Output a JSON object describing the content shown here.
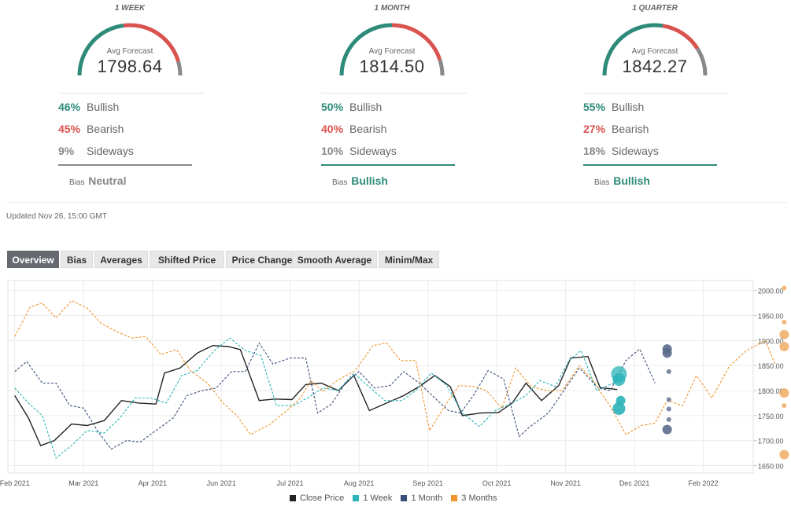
{
  "forecasts": [
    {
      "period": "1 WEEK",
      "avg_label": "Avg Forecast",
      "avg_value": "1798.64",
      "bullish_pct": "46%",
      "bullish_label": "Bullish",
      "bearish_pct": "45%",
      "bearish_label": "Bearish",
      "sideways_pct": "9%",
      "sideways_label": "Sideways",
      "bias_label": "Bias",
      "bias_value": "Neutral",
      "bias_color": "#888888",
      "gauge": {
        "bullish": 0.46,
        "bearish": 0.45,
        "sideways": 0.09
      }
    },
    {
      "period": "1 MONTH",
      "avg_label": "Avg Forecast",
      "avg_value": "1814.50",
      "bullish_pct": "50%",
      "bullish_label": "Bullish",
      "bearish_pct": "40%",
      "bearish_label": "Bearish",
      "sideways_pct": "10%",
      "sideways_label": "Sideways",
      "bias_label": "Bias",
      "bias_value": "Bullish",
      "bias_color": "#2e8b7a",
      "gauge": {
        "bullish": 0.5,
        "bearish": 0.4,
        "sideways": 0.1
      }
    },
    {
      "period": "1 QUARTER",
      "avg_label": "Avg Forecast",
      "avg_value": "1842.27",
      "bullish_pct": "55%",
      "bullish_label": "Bullish",
      "bearish_pct": "27%",
      "bearish_label": "Bearish",
      "sideways_pct": "18%",
      "sideways_label": "Sideways",
      "bias_label": "Bias",
      "bias_value": "Bullish",
      "bias_color": "#2e8b7a",
      "gauge": {
        "bullish": 0.55,
        "bearish": 0.27,
        "sideways": 0.18
      }
    }
  ],
  "colors": {
    "bullish": "#2e8b7a",
    "bearish": "#d9534f",
    "sideways": "#888888"
  },
  "updated": "Updated Nov 26, 15:00 GMT",
  "tabs": [
    {
      "label": "Overview",
      "active": true
    },
    {
      "label": "Bias",
      "active": false
    },
    {
      "label": "Averages",
      "active": false
    },
    {
      "label": "Shifted Price",
      "active": false
    },
    {
      "label": "Price Change",
      "active": false
    },
    {
      "label": "Smooth Average",
      "active": false
    },
    {
      "label": "Minim/Max",
      "active": false
    }
  ],
  "chart_data": {
    "type": "line",
    "x_ticks": [
      "Feb 2021",
      "Mar 2021",
      "Apr 2021",
      "Jun 2021",
      "Jul 2021",
      "Aug 2021",
      "Sep 2021",
      "Oct 2021",
      "Nov 2021",
      "Dec 2021",
      "Feb 2022"
    ],
    "x_tick_weeks": [
      0,
      4,
      8,
      12,
      16,
      20,
      24,
      28,
      32,
      36,
      40
    ],
    "y_ticks": [
      "2000.00",
      "1950.00",
      "1900.00",
      "1850.00",
      "1800.00",
      "1750.00",
      "1700.00",
      "1650.00"
    ],
    "ylim": [
      1635,
      2020
    ],
    "xlim": [
      -0.4,
      42.9
    ],
    "grid": true,
    "legend_position": "bottom",
    "series": [
      {
        "name": "Close Price",
        "color": "#222222",
        "dashed": false,
        "values": [
          [
            0,
            1790
          ],
          [
            0.8,
            1745
          ],
          [
            1.5,
            1690
          ],
          [
            2.3,
            1700
          ],
          [
            3.3,
            1733
          ],
          [
            4.2,
            1730
          ],
          [
            5.2,
            1740
          ],
          [
            6.2,
            1780
          ],
          [
            7.2,
            1775
          ],
          [
            8.2,
            1773
          ],
          [
            8.7,
            1835
          ],
          [
            9.6,
            1845
          ],
          [
            10.6,
            1875
          ],
          [
            11.5,
            1890
          ],
          [
            12.4,
            1888
          ],
          [
            13.1,
            1882
          ],
          [
            14.2,
            1780
          ],
          [
            15.1,
            1783
          ],
          [
            16.1,
            1782
          ],
          [
            16.9,
            1812
          ],
          [
            17.8,
            1815
          ],
          [
            18.8,
            1800
          ],
          [
            19.7,
            1830
          ],
          [
            20.6,
            1760
          ],
          [
            21.6,
            1775
          ],
          [
            22.6,
            1790
          ],
          [
            23.5,
            1808
          ],
          [
            24.4,
            1830
          ],
          [
            25.3,
            1808
          ],
          [
            26.0,
            1750
          ],
          [
            27.1,
            1755
          ],
          [
            28.1,
            1756
          ],
          [
            28.9,
            1775
          ],
          [
            29.7,
            1815
          ],
          [
            30.6,
            1780
          ],
          [
            31.6,
            1810
          ],
          [
            32.3,
            1865
          ],
          [
            33.3,
            1868
          ],
          [
            34.0,
            1806
          ],
          [
            35.0,
            1802
          ]
        ]
      },
      {
        "name": "1 Week",
        "color": "#2ab3b8",
        "dashed": true,
        "values": [
          [
            0,
            1805
          ],
          [
            0.8,
            1775
          ],
          [
            1.6,
            1750
          ],
          [
            2.4,
            1665
          ],
          [
            3.3,
            1690
          ],
          [
            4.2,
            1720
          ],
          [
            5.2,
            1715
          ],
          [
            6.1,
            1745
          ],
          [
            7.0,
            1785
          ],
          [
            7.9,
            1785
          ],
          [
            8.8,
            1775
          ],
          [
            9.7,
            1830
          ],
          [
            10.6,
            1840
          ],
          [
            11.6,
            1880
          ],
          [
            12.5,
            1905
          ],
          [
            13.4,
            1880
          ],
          [
            14.3,
            1870
          ],
          [
            15.2,
            1770
          ],
          [
            16.2,
            1770
          ],
          [
            17.0,
            1785
          ],
          [
            17.9,
            1805
          ],
          [
            18.8,
            1800
          ],
          [
            19.7,
            1835
          ],
          [
            20.5,
            1810
          ],
          [
            21.5,
            1780
          ],
          [
            22.5,
            1780
          ],
          [
            23.3,
            1800
          ],
          [
            24.2,
            1835
          ],
          [
            25.1,
            1810
          ],
          [
            26.0,
            1755
          ],
          [
            27.0,
            1728
          ],
          [
            27.9,
            1760
          ],
          [
            28.9,
            1775
          ],
          [
            29.7,
            1790
          ],
          [
            30.5,
            1820
          ],
          [
            31.4,
            1808
          ],
          [
            32.2,
            1860
          ],
          [
            32.9,
            1880
          ],
          [
            33.8,
            1800
          ],
          [
            35.1,
            1820
          ]
        ]
      },
      {
        "name": "1 Month",
        "color": "#3a4f7a",
        "dashed": true,
        "values": [
          [
            0,
            1838
          ],
          [
            0.7,
            1858
          ],
          [
            1.6,
            1815
          ],
          [
            2.4,
            1815
          ],
          [
            3.2,
            1770
          ],
          [
            4.0,
            1765
          ],
          [
            4.8,
            1720
          ],
          [
            5.6,
            1683
          ],
          [
            6.5,
            1700
          ],
          [
            7.3,
            1697
          ],
          [
            8.2,
            1720
          ],
          [
            9.2,
            1745
          ],
          [
            10.0,
            1790
          ],
          [
            10.9,
            1800
          ],
          [
            11.7,
            1805
          ],
          [
            12.6,
            1838
          ],
          [
            13.4,
            1838
          ],
          [
            14.2,
            1895
          ],
          [
            15.0,
            1853
          ],
          [
            16.0,
            1865
          ],
          [
            16.9,
            1865
          ],
          [
            17.6,
            1755
          ],
          [
            18.4,
            1773
          ],
          [
            19.2,
            1815
          ],
          [
            20.0,
            1838
          ],
          [
            20.9,
            1805
          ],
          [
            21.8,
            1810
          ],
          [
            22.6,
            1838
          ],
          [
            23.5,
            1815
          ],
          [
            24.4,
            1785
          ],
          [
            25.2,
            1760
          ],
          [
            25.9,
            1755
          ],
          [
            26.7,
            1793
          ],
          [
            27.5,
            1840
          ],
          [
            28.4,
            1823
          ],
          [
            29.3,
            1708
          ],
          [
            29.9,
            1727
          ],
          [
            31.0,
            1755
          ],
          [
            31.8,
            1795
          ],
          [
            32.8,
            1845
          ],
          [
            33.9,
            1805
          ],
          [
            34.6,
            1800
          ],
          [
            35.5,
            1860
          ],
          [
            36.3,
            1883
          ],
          [
            37.2,
            1815
          ]
        ]
      },
      {
        "name": "3 Months",
        "color": "#f0952e",
        "dashed": true,
        "values": [
          [
            0,
            1908
          ],
          [
            0.9,
            1967
          ],
          [
            1.6,
            1975
          ],
          [
            2.4,
            1945
          ],
          [
            3.3,
            1980
          ],
          [
            4.2,
            1965
          ],
          [
            5.0,
            1935
          ],
          [
            5.9,
            1918
          ],
          [
            6.8,
            1905
          ],
          [
            7.6,
            1908
          ],
          [
            8.5,
            1872
          ],
          [
            9.4,
            1882
          ],
          [
            10.2,
            1840
          ],
          [
            11.2,
            1815
          ],
          [
            12.1,
            1775
          ],
          [
            12.9,
            1750
          ],
          [
            13.7,
            1712
          ],
          [
            14.8,
            1732
          ],
          [
            15.8,
            1760
          ],
          [
            16.6,
            1785
          ],
          [
            17.2,
            1820
          ],
          [
            17.9,
            1798
          ],
          [
            18.8,
            1822
          ],
          [
            19.8,
            1840
          ],
          [
            20.8,
            1890
          ],
          [
            21.6,
            1895
          ],
          [
            22.4,
            1860
          ],
          [
            23.3,
            1860
          ],
          [
            24.1,
            1720
          ],
          [
            25.0,
            1770
          ],
          [
            25.8,
            1810
          ],
          [
            26.7,
            1808
          ],
          [
            27.4,
            1800
          ],
          [
            28.3,
            1765
          ],
          [
            29.1,
            1845
          ],
          [
            30.0,
            1808
          ],
          [
            30.9,
            1800
          ],
          [
            31.8,
            1800
          ],
          [
            32.8,
            1850
          ],
          [
            33.6,
            1820
          ],
          [
            34.6,
            1768
          ],
          [
            35.5,
            1712
          ],
          [
            36.4,
            1730
          ],
          [
            37.2,
            1735
          ],
          [
            37.9,
            1780
          ],
          [
            38.8,
            1770
          ],
          [
            39.6,
            1830
          ],
          [
            40.5,
            1785
          ],
          [
            41.5,
            1848
          ],
          [
            42.5,
            1880
          ],
          [
            43.6,
            1900
          ],
          [
            44.2,
            1850
          ]
        ]
      }
    ],
    "forecast_points": [
      {
        "series": "1 Week",
        "x": 35.1,
        "y": 1833,
        "r": 10,
        "color": "#2ab3b8",
        "opacity": 0.75
      },
      {
        "series": "1 Week",
        "x": 35.1,
        "y": 1822,
        "r": 8,
        "color": "#2ab3b8",
        "opacity": 0.85
      },
      {
        "series": "1 Week",
        "x": 35.2,
        "y": 1780,
        "r": 6,
        "color": "#2ab3b8",
        "opacity": 0.9
      },
      {
        "series": "1 Week",
        "x": 35.1,
        "y": 1764,
        "r": 8,
        "color": "#2ab3b8",
        "opacity": 0.9
      },
      {
        "series": "1 Month",
        "x": 37.9,
        "y": 1883,
        "r": 6,
        "color": "#5a6a8a",
        "opacity": 0.9
      },
      {
        "series": "1 Month",
        "x": 37.9,
        "y": 1875,
        "r": 6,
        "color": "#5a6a8a",
        "opacity": 0.9
      },
      {
        "series": "1 Month",
        "x": 38.0,
        "y": 1838,
        "r": 3,
        "color": "#5a6a8a",
        "opacity": 0.8
      },
      {
        "series": "1 Month",
        "x": 38.0,
        "y": 1782,
        "r": 3,
        "color": "#5a6a8a",
        "opacity": 0.8
      },
      {
        "series": "1 Month",
        "x": 38.0,
        "y": 1763,
        "r": 3,
        "color": "#5a6a8a",
        "opacity": 0.8
      },
      {
        "series": "1 Month",
        "x": 38.0,
        "y": 1742,
        "r": 3,
        "color": "#5a6a8a",
        "opacity": 0.8
      },
      {
        "series": "1 Month",
        "x": 37.9,
        "y": 1722,
        "r": 6,
        "color": "#5a6a8a",
        "opacity": 0.9
      },
      {
        "series": "3 Months",
        "x": 44.7,
        "y": 2005,
        "r": 3,
        "color": "#f0b06a",
        "opacity": 0.9
      },
      {
        "series": "3 Months",
        "x": 44.7,
        "y": 1937,
        "r": 3,
        "color": "#f0b06a",
        "opacity": 0.9
      },
      {
        "series": "3 Months",
        "x": 44.7,
        "y": 1912,
        "r": 6,
        "color": "#f0b06a",
        "opacity": 0.9
      },
      {
        "series": "3 Months",
        "x": 44.7,
        "y": 1888,
        "r": 6,
        "color": "#f0b06a",
        "opacity": 0.9
      },
      {
        "series": "3 Months",
        "x": 44.7,
        "y": 1795,
        "r": 6,
        "color": "#f0b06a",
        "opacity": 0.9
      },
      {
        "series": "3 Months",
        "x": 44.7,
        "y": 1770,
        "r": 3,
        "color": "#f0b06a",
        "opacity": 0.9
      },
      {
        "series": "3 Months",
        "x": 44.7,
        "y": 1672,
        "r": 6,
        "color": "#f0b06a",
        "opacity": 0.9
      }
    ]
  }
}
